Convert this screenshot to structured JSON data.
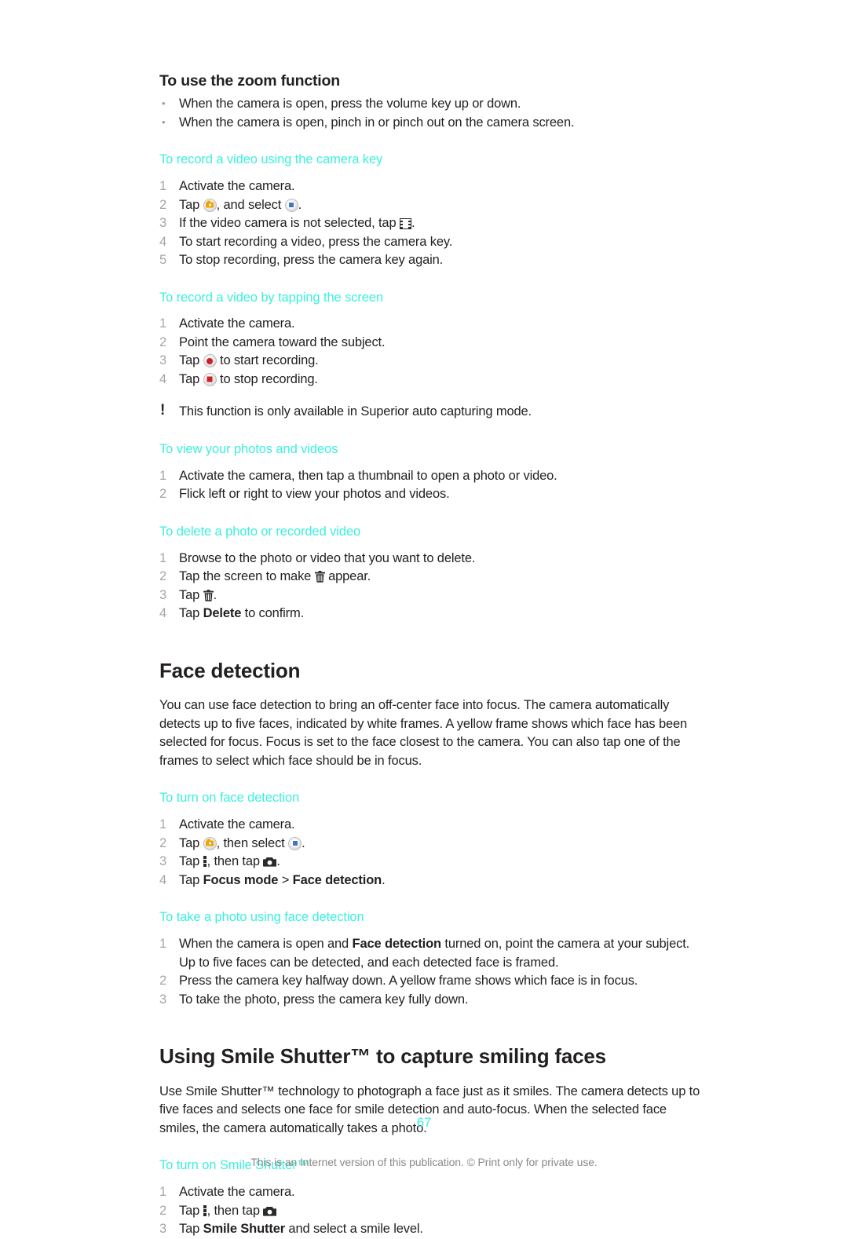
{
  "document": {
    "page_number": "67",
    "disclaimer": "This is an Internet version of this publication. © Print only for private use.",
    "accent_color": "#3cf0dd",
    "text_color": "#231f20",
    "number_color": "#a6a6a6"
  },
  "sections": [
    {
      "id": "zoom-function",
      "heading": "To use the zoom function",
      "bullets": [
        "When the camera is open, press the volume key up or down.",
        "When the camera is open, pinch in or pinch out on the camera screen."
      ]
    }
  ],
  "procedures": {
    "record_video_camera_key": {
      "title": "To record a video using the camera key",
      "steps": [
        {
          "num": "1",
          "pre": "Activate the camera.",
          "post": ""
        },
        {
          "num": "2",
          "pre": "Tap ",
          "mid": ", and select ",
          "post": "."
        },
        {
          "num": "3",
          "pre": "If the video camera is not selected, tap ",
          "post": "."
        },
        {
          "num": "4",
          "pre": "To start recording a video, press the camera key.",
          "post": ""
        },
        {
          "num": "5",
          "pre": "To stop recording, press the camera key again.",
          "post": ""
        }
      ]
    },
    "record_video_tapping": {
      "title": "To record a video by tapping the screen",
      "steps": [
        {
          "num": "1",
          "pre": "Activate the camera.",
          "post": ""
        },
        {
          "num": "2",
          "pre": "Point the camera toward the subject.",
          "post": ""
        },
        {
          "num": "3",
          "pre": "Tap ",
          "post": " to start recording."
        },
        {
          "num": "4",
          "pre": "Tap ",
          "post": " to stop recording."
        }
      ],
      "note": "This function is only available in Superior auto capturing mode."
    },
    "view_photos_videos": {
      "title": "To view your photos and videos",
      "steps": [
        {
          "num": "1",
          "pre": "Activate the camera, then tap a thumbnail to open a photo or video.",
          "post": ""
        },
        {
          "num": "2",
          "pre": "Flick left or right to view your photos and videos.",
          "post": ""
        }
      ]
    },
    "delete_photo_video": {
      "title": "To delete a photo or recorded video",
      "steps": [
        {
          "num": "1",
          "pre": "Browse to the photo or video that you want to delete.",
          "post": ""
        },
        {
          "num": "2",
          "pre": "Tap the screen to make ",
          "post": " appear."
        },
        {
          "num": "3",
          "pre": "Tap ",
          "post": "."
        },
        {
          "num": "4",
          "pre": "Tap ",
          "bold": "Delete",
          "post": " to confirm."
        }
      ]
    },
    "turn_on_face_detection": {
      "title": "To turn on face detection",
      "steps": [
        {
          "num": "1",
          "pre": "Activate the camera.",
          "post": ""
        },
        {
          "num": "2",
          "pre": "Tap ",
          "mid": ", then select ",
          "post": "."
        },
        {
          "num": "3",
          "pre": "Tap ",
          "mid": ", then tap ",
          "post": "."
        },
        {
          "num": "4",
          "pre": "Tap ",
          "bold": "Focus mode",
          "mid": " > ",
          "bold2": "Face detection",
          "post": "."
        }
      ]
    },
    "take_photo_face_detection": {
      "title": "To take a photo using face detection",
      "steps": [
        {
          "num": "1",
          "pre": "When the camera is open and ",
          "bold": "Face detection",
          "post": " turned on, point the camera at your subject. Up to five faces can be detected, and each detected face is framed."
        },
        {
          "num": "2",
          "pre": "Press the camera key halfway down. A yellow frame shows which face is in focus.",
          "post": ""
        },
        {
          "num": "3",
          "pre": "To take the photo, press the camera key fully down.",
          "post": ""
        }
      ]
    },
    "turn_on_smile_shutter": {
      "title": "To turn on Smile Shutter™",
      "steps": [
        {
          "num": "1",
          "pre": "Activate the camera.",
          "post": ""
        },
        {
          "num": "2",
          "pre": "Tap ",
          "mid": ", then tap ",
          "post": ""
        },
        {
          "num": "3",
          "pre": "Tap ",
          "bold": "Smile Shutter",
          "post": " and select a smile level."
        }
      ]
    }
  },
  "face_detection": {
    "heading": "Face detection",
    "body": "You can use face detection to bring an off-center face into focus. The camera automatically detects up to five faces, indicated by white frames. A yellow frame shows which face has been selected for focus. Focus is set to the face closest to the camera. You can also tap one of the frames to select which face should be in focus."
  },
  "smile_shutter": {
    "heading": "Using Smile Shutter™ to capture smiling faces",
    "body": "Use Smile Shutter™ technology to photograph a face just as it smiles. The camera detects up to five faces and selects one face for smile detection and auto-focus. When the selected face smiles, the camera automatically takes a photo."
  },
  "icons": {
    "camera_mode": "camera-mode-icon",
    "video_app": "video-app-icon",
    "film_strip": "film-strip-icon",
    "record_start": "record-start-icon",
    "record_stop": "record-stop-icon",
    "trash": "trash-icon",
    "menu_dots": "vertical-dots-menu-icon",
    "camera": "camera-icon",
    "warning": "warning-exclamation-icon"
  }
}
